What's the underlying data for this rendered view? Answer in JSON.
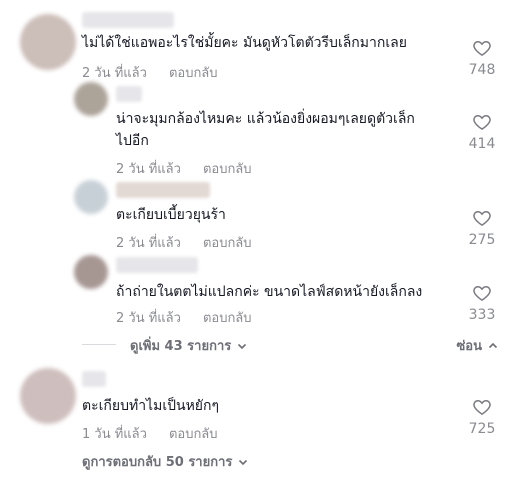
{
  "thread": {
    "top_comment": {
      "username": "user",
      "text": "ไม่ได้ใช่แอพอะไรใช่มั้ยคะ มันดูหัวโตตัวรีบเล็กมากเลย",
      "time": "2 วัน ที่แล้ว",
      "reply_label": "ตอบกลับ",
      "likes": "748",
      "avatar_color": "#c7b7b1"
    },
    "replies": [
      {
        "username": "user",
        "text_line1": "น่าจะมุมกล้องไหมคะ แล้วน้องยิ่งผอมๆเลยดูตัวเล็ก",
        "text_line2": "ไปอีก",
        "time": "2 วัน ที่แล้ว",
        "reply_label": "ตอบกลับ",
        "likes": "414",
        "avatar_color": "#a49a8f"
      },
      {
        "username": "user",
        "text_line1": "ตะเกียบเบี้ยวยุนร้า",
        "time": "2 วัน ที่แล้ว",
        "reply_label": "ตอบกลับ",
        "likes": "275",
        "avatar_color": "#c2ccd3"
      },
      {
        "username": "user",
        "text_line1": "ถ้าถ่ายในตตไม่แปลกค่ะ ขนาดไลฟ์สดหน้ายังเล็กลง",
        "time": "2 วัน ที่แล้ว",
        "reply_label": "ตอบกลับ",
        "likes": "333",
        "avatar_color": "#9d8c88"
      }
    ],
    "view_more_label": "ดูเพิ่ม 43 รายการ",
    "hide_label": "ซ่อน"
  },
  "second_comment": {
    "username": "user",
    "text": "ตะเกียบทำไมเป็นหยักๆ",
    "time": "1 วัน ที่แล้ว",
    "reply_label": "ตอบกลับ",
    "likes": "725",
    "avatar_color": "#c9b8b6",
    "view_replies_label": "ดูการตอบกลับ 50 รายการ"
  },
  "icons": {
    "like": "heart-outline-icon",
    "expand": "chevron-down-icon",
    "collapse": "chevron-up-icon"
  }
}
